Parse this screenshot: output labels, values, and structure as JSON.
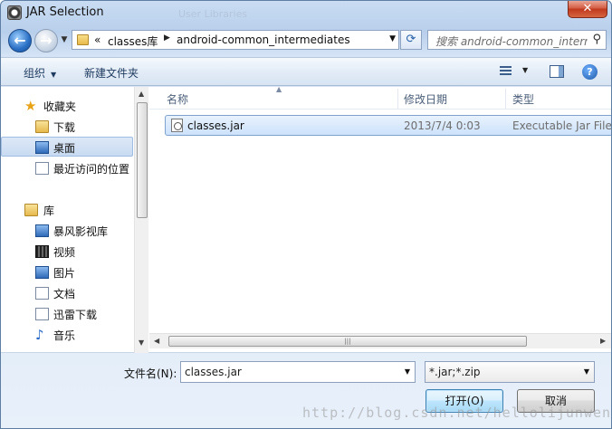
{
  "window": {
    "title": "JAR Selection",
    "background_title": "User Libraries",
    "close_glyph": "✕"
  },
  "address": {
    "overflow": "«",
    "crumbs": [
      "classes库",
      "android-common_intermediates"
    ]
  },
  "search": {
    "placeholder": "搜索 android-common_intermediates"
  },
  "toolbar": {
    "organize": "组织",
    "new_folder": "新建文件夹"
  },
  "nav": {
    "items": [
      {
        "label": "收藏夹",
        "icon": "star-icon"
      },
      {
        "label": "下载",
        "icon": "download-folder-icon"
      },
      {
        "label": "桌面",
        "icon": "desktop-icon",
        "selected": true
      },
      {
        "label": "最近访问的位置",
        "icon": "recent-places-icon"
      },
      {
        "label": "库",
        "icon": "library-icon"
      },
      {
        "label": "暴风影视库",
        "icon": "video-library-icon"
      },
      {
        "label": "视频",
        "icon": "video-icon"
      },
      {
        "label": "图片",
        "icon": "pictures-icon"
      },
      {
        "label": "文档",
        "icon": "documents-icon"
      },
      {
        "label": "迅雷下载",
        "icon": "thunder-download-icon"
      },
      {
        "label": "音乐",
        "icon": "music-icon"
      }
    ]
  },
  "files": {
    "columns": [
      "名称",
      "修改日期",
      "类型"
    ],
    "rows": [
      {
        "name": "classes.jar",
        "modified": "2013/7/4 0:03",
        "type": "Executable Jar File"
      }
    ]
  },
  "footer": {
    "filename_label": "文件名(N):",
    "filename_value": "classes.jar",
    "filetype_value": "*.jar;*.zip",
    "open_label": "打开(O)",
    "cancel_label": "取消",
    "watermark": "http://blog.csdn.net/hellolijunwen"
  },
  "colors": {
    "accent": "#3c7fb1",
    "selection": "#cde2fb",
    "close": "#c0381d"
  }
}
